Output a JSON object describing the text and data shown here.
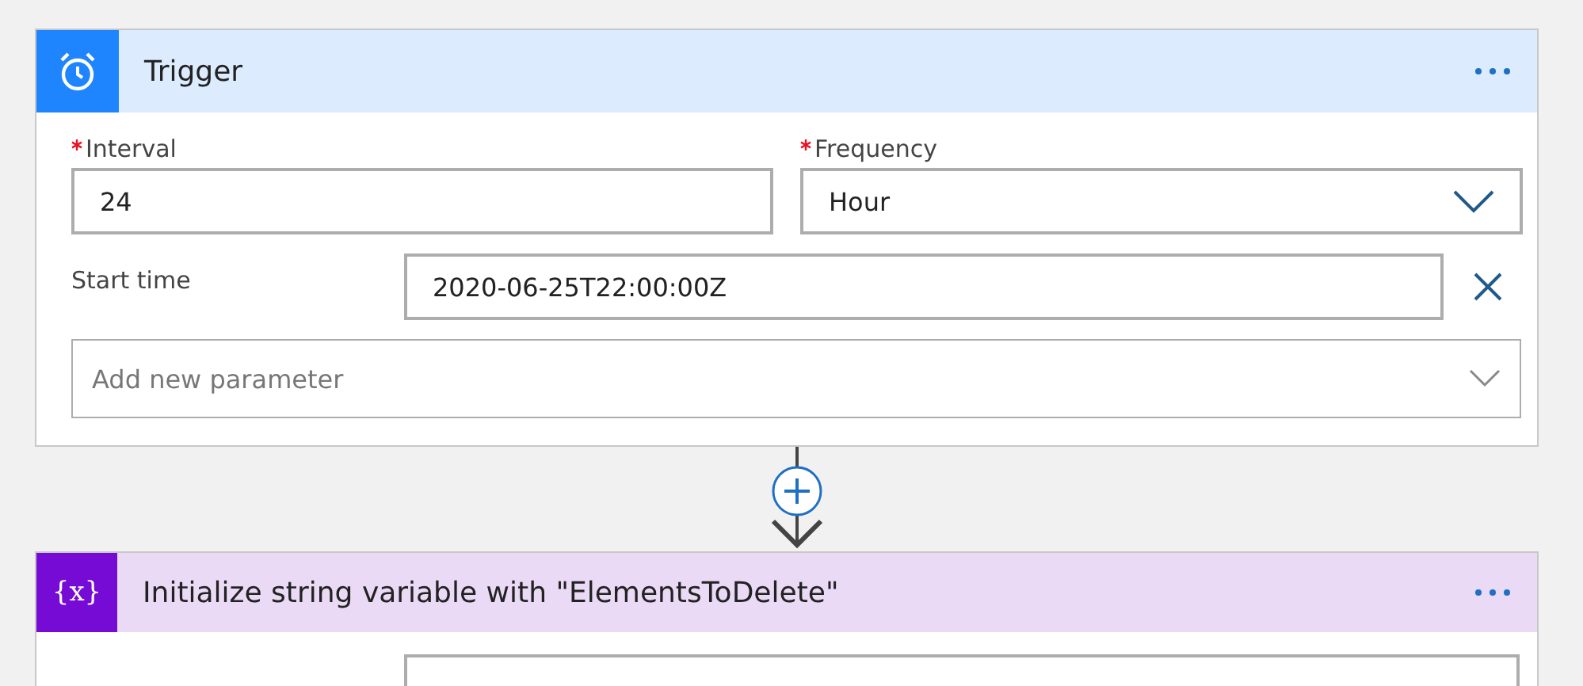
{
  "cards": [
    {
      "kind": "trigger",
      "title": "Trigger",
      "fields": [
        {
          "kind": "pair",
          "items": [
            {
              "label": "Interval",
              "required": true,
              "value": "24",
              "dropdown": false
            },
            {
              "label": "Frequency",
              "required": true,
              "value": "Hour",
              "dropdown": true
            }
          ]
        },
        {
          "kind": "inline",
          "label": "Start time",
          "value": "2020-06-25T22:00:00Z",
          "clearable": true
        },
        {
          "kind": "picker",
          "placeholder": "Add new parameter"
        }
      ]
    },
    {
      "kind": "variable",
      "icon_text": "{x}",
      "title": "Initialize string variable with \"ElementsToDelete\"",
      "fields": [
        {
          "kind": "partial"
        }
      ]
    }
  ]
}
